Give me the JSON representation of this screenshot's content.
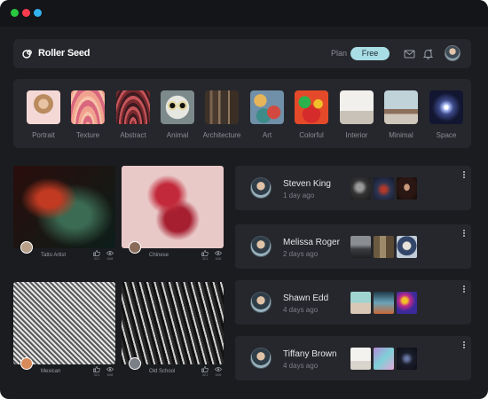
{
  "window": {
    "controls": [
      "close",
      "minimize",
      "zoom"
    ]
  },
  "header": {
    "logo_text": "Roller Seed",
    "plan_label": "Plan",
    "plan_value": "Free",
    "icons": [
      "mail-icon",
      "bell-icon"
    ]
  },
  "categories": [
    {
      "label": "Portrait"
    },
    {
      "label": "Texture"
    },
    {
      "label": "Abstract"
    },
    {
      "label": "Animal"
    },
    {
      "label": "Architecture"
    },
    {
      "label": "Art"
    },
    {
      "label": "Colorful"
    },
    {
      "label": "Interior"
    },
    {
      "label": "Minimal"
    },
    {
      "label": "Space"
    }
  ],
  "cards": [
    {
      "name": "Tatto Artist",
      "likes": "321",
      "views": "608"
    },
    {
      "name": "Chinese",
      "likes": "321",
      "views": "608"
    },
    {
      "name": "Mexican",
      "likes": "321",
      "views": "608"
    },
    {
      "name": "Old School",
      "likes": "321",
      "views": "608"
    }
  ],
  "feed": [
    {
      "name": "Steven King",
      "time": "1 day ago"
    },
    {
      "name": "Melissa Roger",
      "time": "2 days ago"
    },
    {
      "name": "Shawn Edd",
      "time": "4 days ago"
    },
    {
      "name": "Tiffany Brown",
      "time": "4 days ago"
    }
  ],
  "colors": {
    "background": "#1b1c20",
    "panel": "#26272c",
    "accent": "#a8dde6"
  }
}
